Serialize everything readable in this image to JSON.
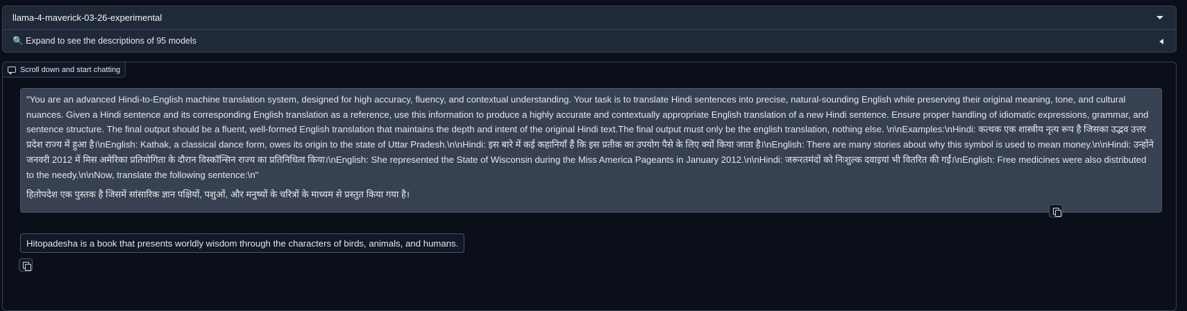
{
  "model_selector": {
    "selected": "llama-4-maverick-03-26-experimental",
    "icon": "chevron-down-icon"
  },
  "models_accordion": {
    "label": "🔍 Expand to see the descriptions of 95 models",
    "icon": "triangle-left-icon"
  },
  "chatbot": {
    "label": "Scroll down and start chatting",
    "messages": [
      {
        "role": "user",
        "paragraphs": [
          "\"You are an advanced Hindi-to-English machine translation system, designed for high accuracy, fluency, and contextual understanding. Your task is to translate Hindi sentences into precise, natural-sounding English while preserving their original meaning, tone, and cultural nuances. Given a Hindi sentence and its corresponding English translation as a reference, use this information to produce a highly accurate and contextually appropriate English translation of a new Hindi sentence. Ensure proper handling of idiomatic expressions, grammar, and sentence structure. The final output should be a fluent, well-formed English translation that maintains the depth and intent of the original Hindi text.The final output must only be the english translation, nothing else. \\n\\nExamples:\\nHindi: कत्थक एक शास्त्रीय नृत्य रूप है जिसका उद्भव उत्तर प्रदेश राज्य में हुआ है।\\nEnglish: Kathak, a classical dance form, owes its origin to the state of Uttar Pradesh.\\n\\nHindi: इस बारे में कई कहानियाँ हैं कि इस प्रतीक का उपयोग पैसे के लिए क्यों किया जाता है।\\nEnglish: There are many stories about why this symbol is used to mean money.\\n\\nHindi: उन्होंने जनवरी 2012 में मिस अमेरिका प्रतियोगिता के दौरान विस्कॉन्सिन राज्य का प्रतिनिधित्व किया।\\nEnglish: She represented the State of Wisconsin during the Miss America Pageants in January 2012.\\n\\nHindi: जरूरतमंदों को निःशुल्क दवाइयां भी वितरित की गईं।\\nEnglish: Free medicines were also distributed to the needy.\\n\\nNow, translate the following sentence:\\n\"",
          "हितोपदेश एक पुस्तक है जिसमें सांसारिक ज्ञान पक्षियों, पशुओं, और मनुष्यों के चरित्रों के माध्यम से प्रस्तुत किया गया है।"
        ],
        "copy_icon": "copy-icon"
      },
      {
        "role": "assistant",
        "text": "Hitopadesha is a book that presents worldly wisdom through the characters of birds, animals, and humans.",
        "copy_icon": "copy-icon"
      }
    ]
  },
  "colors": {
    "background": "#0b0f19",
    "panel": "#1f2937",
    "user_bubble": "#374151",
    "border": "#4b5563"
  }
}
